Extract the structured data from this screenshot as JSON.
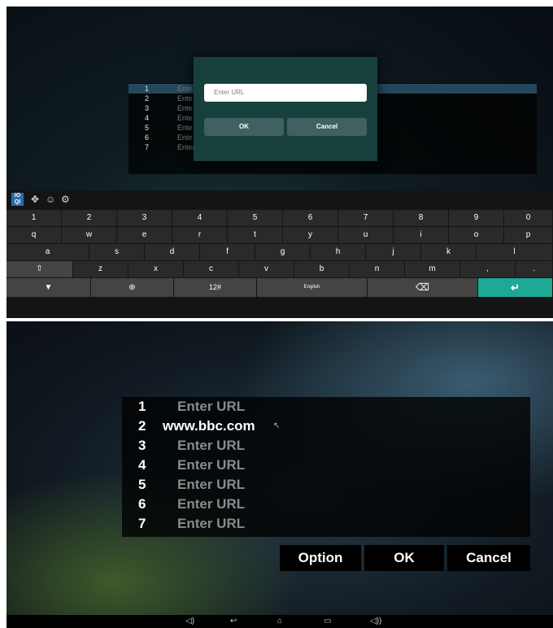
{
  "top": {
    "list_numbers": [
      "1",
      "2",
      "3",
      "4",
      "5",
      "6",
      "7"
    ],
    "list_text_fragments": [
      "Ente",
      "Ente",
      "Ente",
      "Ente",
      "Ente",
      "Ente",
      "Enter URL"
    ],
    "dialog": {
      "url_placeholder": "Enter URL",
      "ok_label": "OK",
      "cancel_label": "Cancel"
    },
    "keyboard": {
      "toolbar_icons": [
        "language-icon",
        "move-icon",
        "emoji-icon",
        "settings-icon"
      ],
      "language_icon_text": "IO QI",
      "number_row": [
        "1",
        "2",
        "3",
        "4",
        "5",
        "6",
        "7",
        "8",
        "9",
        "0"
      ],
      "row1": [
        "q",
        "w",
        "e",
        "r",
        "t",
        "y",
        "u",
        "i",
        "o",
        "p"
      ],
      "row2": [
        "a",
        "s",
        "d",
        "f",
        "g",
        "h",
        "j",
        "k",
        "l"
      ],
      "row3_keys": [
        "z",
        "x",
        "c",
        "v",
        "b",
        "n",
        "m",
        ",",
        "."
      ],
      "shift_symbol": "⇧",
      "hide_symbol": "▼",
      "globe_symbol": "⊕",
      "symbols_label": "12#",
      "space_label": "English",
      "backspace_symbol": "⌫",
      "enter_symbol": "↵"
    }
  },
  "bottom": {
    "rows": [
      {
        "num": "1",
        "text": "Enter URL"
      },
      {
        "num": "2",
        "text": "www.bbc.com"
      },
      {
        "num": "3",
        "text": "Enter URL"
      },
      {
        "num": "4",
        "text": "Enter URL"
      },
      {
        "num": "5",
        "text": "Enter URL"
      },
      {
        "num": "6",
        "text": "Enter URL"
      },
      {
        "num": "7",
        "text": "Enter URL"
      }
    ],
    "buttons": {
      "option_label": "Option",
      "ok_label": "OK",
      "cancel_label": "Cancel"
    },
    "navbar_icons": [
      "volume-down-icon",
      "back-icon",
      "home-icon",
      "recents-icon",
      "volume-up-icon"
    ]
  },
  "colors": {
    "dialog_bg": "#17403d",
    "enter_key": "#1ea896",
    "selection": "#23485b"
  }
}
